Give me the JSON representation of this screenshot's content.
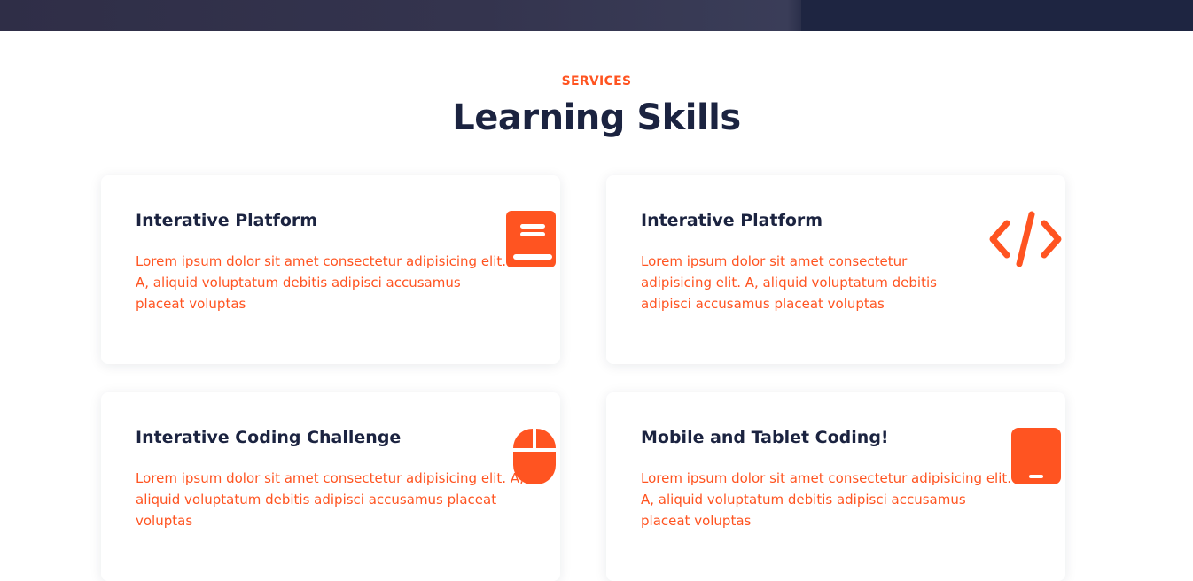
{
  "services": {
    "eyebrow": "SERVICES",
    "title": "Learning Skills",
    "cards": [
      {
        "title": "Interative Platform",
        "description": "Lorem ipsum dolor sit amet consectetur adipisicing elit. A, aliquid voluptatum debitis adipisci accusamus placeat voluptas",
        "icon": "book-icon"
      },
      {
        "title": "Interative Platform",
        "description": "Lorem ipsum dolor sit amet consectetur adipisicing elit. A, aliquid voluptatum debitis adipisci accusamus placeat voluptas",
        "icon": "code-icon"
      },
      {
        "title": "Interative Coding Challenge",
        "description": "Lorem ipsum dolor sit amet consectetur adipisicing elit. A, aliquid voluptatum debitis adipisci accusamus placeat voluptas",
        "icon": "mouse-icon"
      },
      {
        "title": "Mobile and Tablet Coding!",
        "description": "Lorem ipsum dolor sit amet consectetur adipisicing elit. A, aliquid voluptatum debitis adipisci accusamus placeat voluptas",
        "icon": "tablet-icon"
      }
    ]
  },
  "colors": {
    "accent": "#ff5421",
    "heading": "#1b2340",
    "hero_dark": "#1e2541"
  }
}
